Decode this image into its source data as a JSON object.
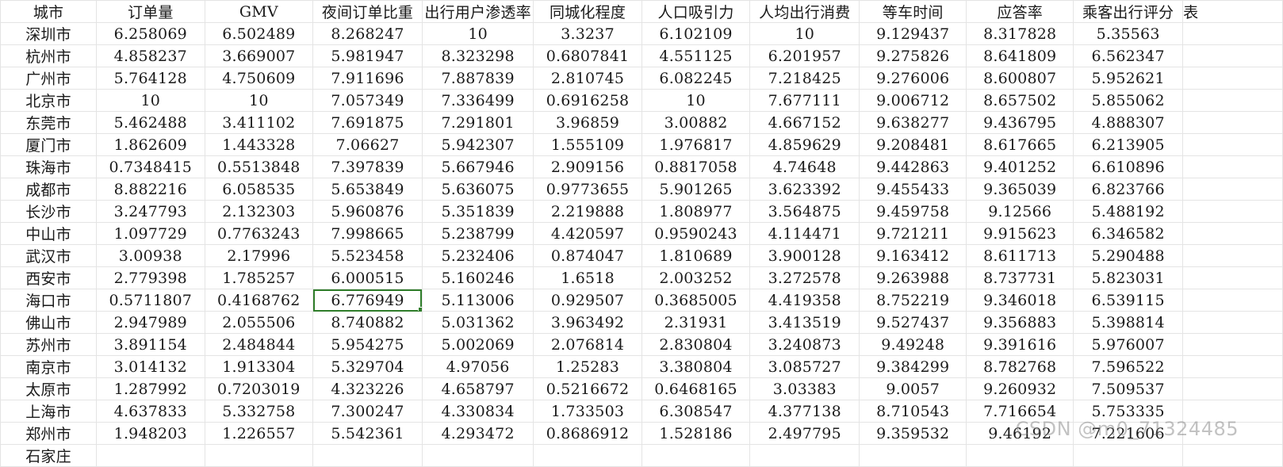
{
  "sheet": {
    "headers": [
      "城市",
      "订单量",
      "GMV",
      "夜间订单比重",
      "出行用户渗透率",
      "同城化程度",
      "人口吸引力",
      "人均出行消费",
      "等车时间",
      "应答率",
      "乘客出行评分",
      "表"
    ],
    "rows": [
      [
        "深圳市",
        "6.258069",
        "6.502489",
        "8.268247",
        "10",
        "3.3237",
        "6.102109",
        "10",
        "9.129437",
        "8.317828",
        "5.35563"
      ],
      [
        "杭州市",
        "4.858237",
        "3.669007",
        "5.981947",
        "8.323298",
        "0.6807841",
        "4.551125",
        "6.201957",
        "9.275826",
        "8.641809",
        "6.562347"
      ],
      [
        "广州市",
        "5.764128",
        "4.750609",
        "7.911696",
        "7.887839",
        "2.810745",
        "6.082245",
        "7.218425",
        "9.276006",
        "8.600807",
        "5.952621"
      ],
      [
        "北京市",
        "10",
        "10",
        "7.057349",
        "7.336499",
        "0.6916258",
        "10",
        "7.677111",
        "9.006712",
        "8.657502",
        "5.855062"
      ],
      [
        "东莞市",
        "5.462488",
        "3.411102",
        "7.691875",
        "7.291801",
        "3.96859",
        "3.00882",
        "4.667152",
        "9.638277",
        "9.436795",
        "4.888307"
      ],
      [
        "厦门市",
        "1.862609",
        "1.443328",
        "7.06627",
        "5.942307",
        "1.555109",
        "1.976817",
        "4.859629",
        "9.208481",
        "8.617665",
        "6.213905"
      ],
      [
        "珠海市",
        "0.7348415",
        "0.5513848",
        "7.397839",
        "5.667946",
        "2.909156",
        "0.8817058",
        "4.74648",
        "9.442863",
        "9.401252",
        "6.610896"
      ],
      [
        "成都市",
        "8.882216",
        "6.058535",
        "5.653849",
        "5.636075",
        "0.9773655",
        "5.901265",
        "3.623392",
        "9.455433",
        "9.365039",
        "6.823766"
      ],
      [
        "长沙市",
        "3.247793",
        "2.132303",
        "5.960876",
        "5.351839",
        "2.219888",
        "1.808977",
        "3.564875",
        "9.459758",
        "9.12566",
        "5.488192"
      ],
      [
        "中山市",
        "1.097729",
        "0.7763243",
        "7.998665",
        "5.238799",
        "4.420597",
        "0.9590243",
        "4.114471",
        "9.721211",
        "9.915623",
        "6.346582"
      ],
      [
        "武汉市",
        "3.00938",
        "2.17996",
        "5.523458",
        "5.232406",
        "0.874047",
        "1.810689",
        "3.900128",
        "9.163412",
        "8.611713",
        "5.290488"
      ],
      [
        "西安市",
        "2.779398",
        "1.785257",
        "6.000515",
        "5.160246",
        "1.6518",
        "2.003252",
        "3.272578",
        "9.263988",
        "8.737731",
        "5.823031"
      ],
      [
        "海口市",
        "0.5711807",
        "0.4168762",
        "6.776949",
        "5.113006",
        "0.929507",
        "0.3685005",
        "4.419358",
        "8.752219",
        "9.346018",
        "6.539115"
      ],
      [
        "佛山市",
        "2.947989",
        "2.055506",
        "8.740882",
        "5.031362",
        "3.963492",
        "2.31931",
        "3.413519",
        "9.527437",
        "9.356883",
        "5.398814"
      ],
      [
        "苏州市",
        "3.891154",
        "2.484844",
        "5.954275",
        "5.002069",
        "2.076814",
        "2.830804",
        "3.240873",
        "9.49248",
        "9.391616",
        "5.976007"
      ],
      [
        "南京市",
        "3.014132",
        "1.913304",
        "5.329704",
        "4.97056",
        "1.25283",
        "3.380804",
        "3.085727",
        "9.384299",
        "8.782768",
        "7.596522"
      ],
      [
        "太原市",
        "1.287992",
        "0.7203019",
        "4.323226",
        "4.658797",
        "0.5216672",
        "0.6468165",
        "3.03383",
        "9.0057",
        "9.260932",
        "7.509537"
      ],
      [
        "上海市",
        "4.637833",
        "5.332758",
        "7.300247",
        "4.330834",
        "1.733503",
        "6.308547",
        "4.377138",
        "8.710543",
        "7.716654",
        "5.753335"
      ],
      [
        "郑州市",
        "1.948203",
        "1.226557",
        "5.542361",
        "4.293472",
        "0.8686912",
        "1.528186",
        "2.497795",
        "9.359532",
        "9.46192",
        "7.221606"
      ]
    ],
    "partial_row_label": "石家庄",
    "selected": {
      "row": 12,
      "col": 3
    },
    "active_header_col": 3
  },
  "watermark": {
    "text": "CSDN @m0_71324485"
  }
}
